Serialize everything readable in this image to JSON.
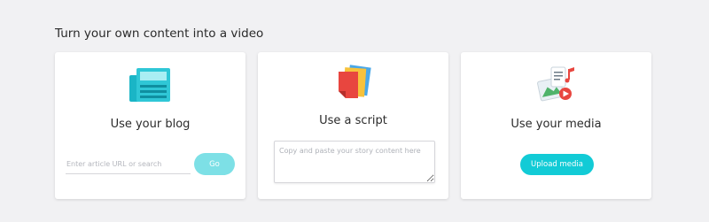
{
  "section_title": "Turn your own content into a video",
  "cards": {
    "blog": {
      "icon": "newspaper-icon",
      "label": "Use your blog",
      "url_input_placeholder": "Enter article URL or search",
      "url_input_value": "",
      "go_label": "Go"
    },
    "script": {
      "icon": "script-pages-icon",
      "label": "Use a script",
      "textarea_placeholder": "Copy and paste your story content here",
      "textarea_value": ""
    },
    "media": {
      "icon": "media-collage-icon",
      "label": "Use your media",
      "upload_label": "Upload media"
    }
  },
  "colors": {
    "page_background": "#f1f1f3",
    "card_background": "#ffffff",
    "accent": "#12cbd6",
    "accent_light": "#7de0e6"
  }
}
